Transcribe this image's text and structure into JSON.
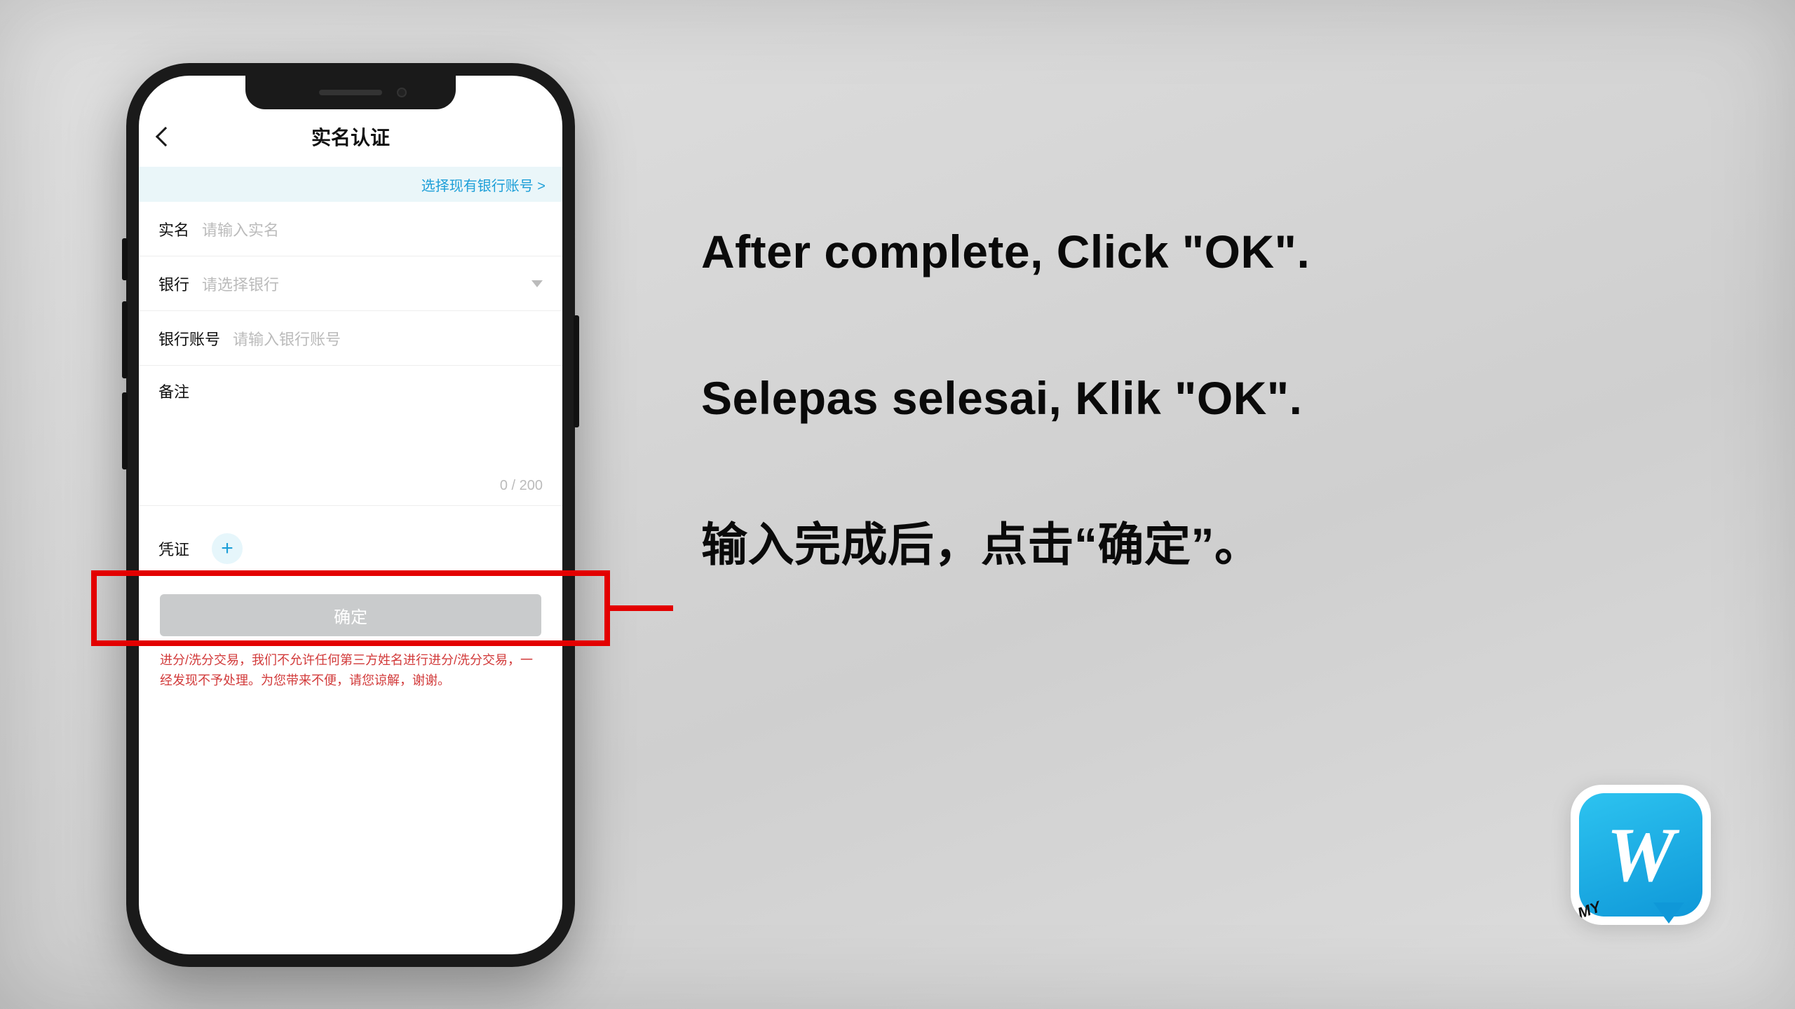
{
  "phone": {
    "title": "实名认证",
    "select_link": "选择现有银行账号 >",
    "fields": {
      "real_name": {
        "label": "实名",
        "placeholder": "请输入实名"
      },
      "bank": {
        "label": "银行",
        "placeholder": "请选择银行"
      },
      "account": {
        "label": "银行账号",
        "placeholder": "请输入银行账号"
      },
      "notes": {
        "label": "备注",
        "counter": "0 / 200"
      },
      "voucher": {
        "label": "凭证"
      }
    },
    "ok_button": "确定",
    "warning": "进分/洗分交易，我们不允许任何第三方姓名进行进分/洗分交易，一经发现不予处理。为您带来不便，请您谅解，谢谢。"
  },
  "instructions": {
    "en": "After complete, Click \"OK\".",
    "ms": "Selepas selesai, Klik \"OK\".",
    "zh": "输入完成后，点击“确定”。"
  },
  "app_icon": {
    "letter": "W",
    "tag": "MY"
  }
}
